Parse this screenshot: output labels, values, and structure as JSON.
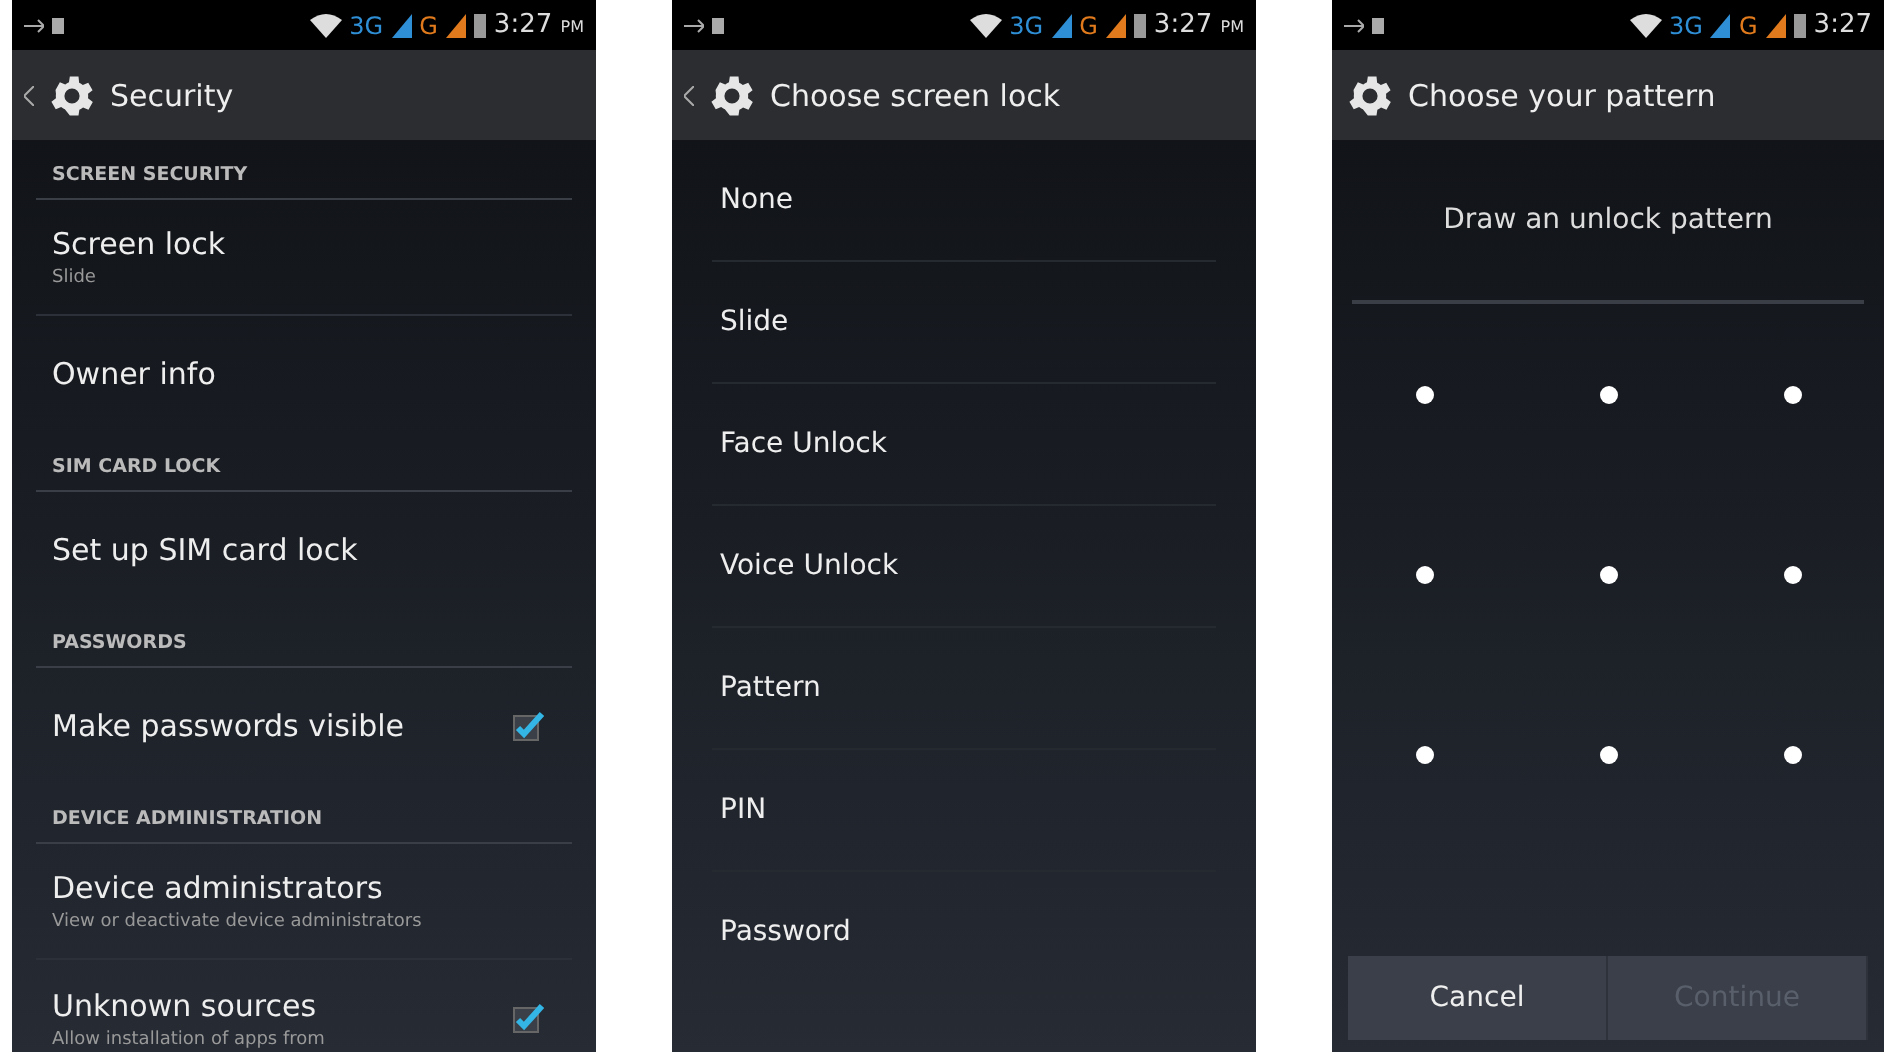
{
  "screens": [
    {
      "kind": "settings",
      "status": {
        "network": "3G",
        "network2": "G",
        "time": "3:27",
        "ampm": "PM"
      },
      "title": "Security",
      "back": true,
      "items": [
        {
          "kind": "header",
          "title": "SCREEN SECURITY"
        },
        {
          "kind": "item",
          "title": "Screen lock",
          "summary": "Slide"
        },
        {
          "kind": "item",
          "title": "Owner info"
        },
        {
          "kind": "header",
          "title": "SIM CARD LOCK"
        },
        {
          "kind": "item",
          "title": "Set up SIM card lock"
        },
        {
          "kind": "header",
          "title": "PASSWORDS"
        },
        {
          "kind": "check",
          "title": "Make passwords visible",
          "checked": true
        },
        {
          "kind": "header",
          "title": "DEVICE ADMINISTRATION"
        },
        {
          "kind": "item",
          "title": "Device administrators",
          "summary": "View or deactivate device administrators"
        },
        {
          "kind": "check",
          "title": "Unknown sources",
          "summary": "Allow installation of apps from",
          "checked": true
        }
      ]
    },
    {
      "kind": "list",
      "status": {
        "network": "3G",
        "network2": "G",
        "time": "3:27",
        "ampm": "PM"
      },
      "title": "Choose screen lock",
      "back": true,
      "options": [
        "None",
        "Slide",
        "Face Unlock",
        "Voice Unlock",
        "Pattern",
        "PIN",
        "Password"
      ]
    },
    {
      "kind": "pattern",
      "status": {
        "network": "3G",
        "network2": "G",
        "time": "3:27"
      },
      "title": "Choose your pattern",
      "back": false,
      "prompt": "Draw an unlock pattern",
      "buttons": [
        {
          "label": "Cancel",
          "disabled": false
        },
        {
          "label": "Continue",
          "disabled": true
        }
      ]
    }
  ]
}
